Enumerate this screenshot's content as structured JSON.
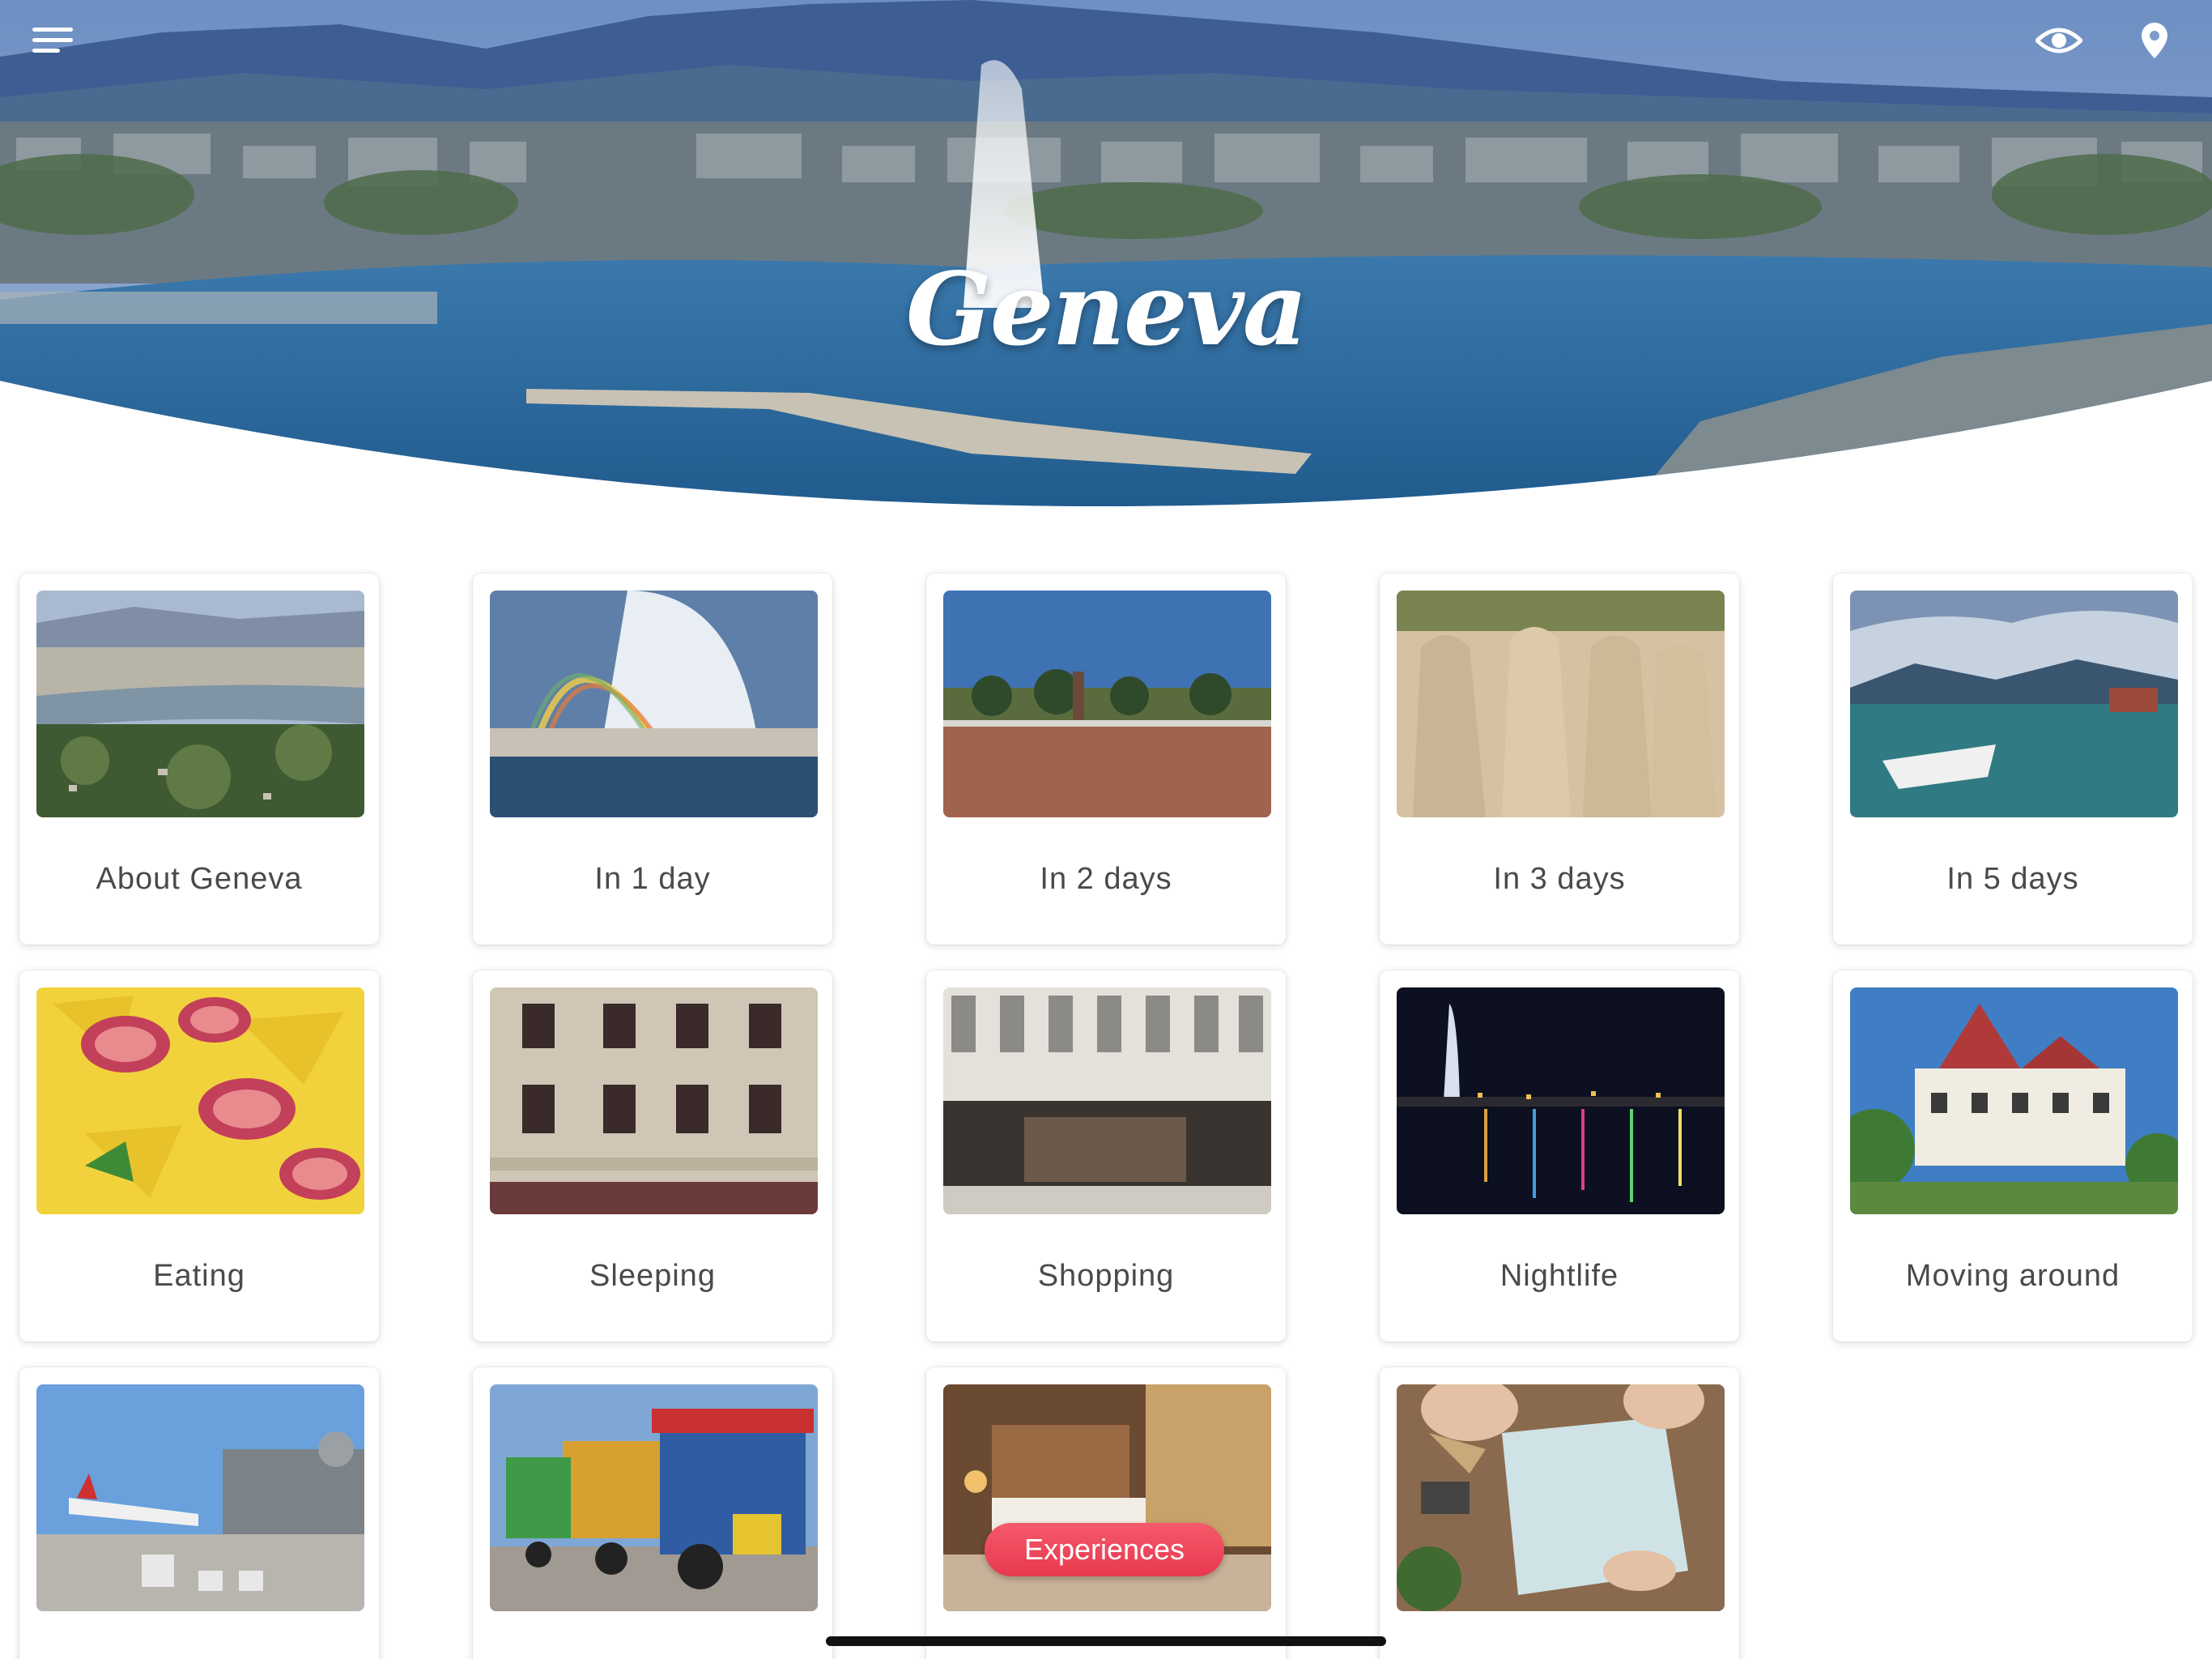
{
  "header": {
    "title": "Geneva",
    "menu_icon": "hamburger-menu-icon",
    "eye_icon": "eye-icon",
    "map_icon": "map-pin-icon"
  },
  "cards": [
    {
      "label": "About Geneva",
      "image": "geneva-aerial-view"
    },
    {
      "label": "In 1 day",
      "image": "jet-deau-rainbow"
    },
    {
      "label": "In 2 days",
      "image": "place-des-nations-broken-chair"
    },
    {
      "label": "In 3 days",
      "image": "reformation-wall-statues"
    },
    {
      "label": "In 5 days",
      "image": "lake-with-boat-mountains"
    },
    {
      "label": "Eating",
      "image": "figs-and-cheese"
    },
    {
      "label": "Sleeping",
      "image": "hotel-de-la-cigogne-facade"
    },
    {
      "label": "Shopping",
      "image": "globus-store-front"
    },
    {
      "label": "Nightlife",
      "image": "geneva-night-lake"
    },
    {
      "label": "Moving around",
      "image": "chateau-ouchy"
    },
    {
      "label": "",
      "image": "airport-plane"
    },
    {
      "label": "",
      "image": "tourist-train"
    },
    {
      "label": "",
      "image": "hotel-room"
    },
    {
      "label": "",
      "image": "travel-map-planning"
    }
  ],
  "experiences_button": {
    "label": "Experiences"
  },
  "colors": {
    "title": "#ffffff",
    "card_label": "#4a4a4a",
    "experiences_pill": "#ec4458",
    "lake": "#2f6d9e"
  }
}
